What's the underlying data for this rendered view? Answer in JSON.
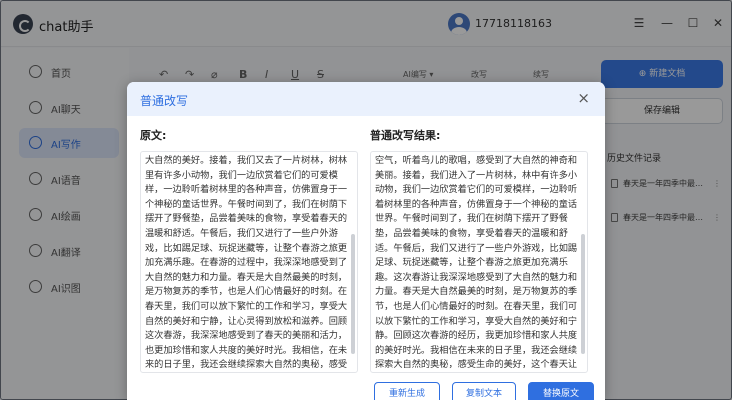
{
  "app": {
    "title": "chat助手",
    "phone": "17718118163",
    "window_controls": [
      "☰",
      "—",
      "☐",
      "✕"
    ]
  },
  "sidebar": {
    "items": [
      {
        "label": "首页",
        "icon": "home-icon",
        "active": false
      },
      {
        "label": "AI聊天",
        "icon": "chat-icon",
        "active": false
      },
      {
        "label": "AI写作",
        "icon": "write-icon",
        "active": true
      },
      {
        "label": "AI语音",
        "icon": "voice-icon",
        "active": false
      },
      {
        "label": "AI绘画",
        "icon": "palette-icon",
        "active": false
      },
      {
        "label": "AI翻译",
        "icon": "translate-icon",
        "active": false
      },
      {
        "label": "AI识图",
        "icon": "scan-icon",
        "active": false
      }
    ]
  },
  "toolbar": {
    "icons": [
      "↶",
      "↷",
      "⌀",
      "B",
      "I",
      "U",
      "S"
    ],
    "labels": [
      "AI编写 ▾",
      "改写",
      "续写"
    ]
  },
  "right_panel": {
    "new_button": "⊕ 新建文档",
    "secondary_button": "保存编辑",
    "history_heading": "历史文件记录",
    "history_items": [
      "春天是一年四季中最…",
      "春天是一年四季中最…"
    ]
  },
  "modal": {
    "title": "普通改写",
    "close_icon": "×",
    "original_label": "原文:",
    "result_label": "普通改写结果:",
    "original_text": "大自然的美好。接着，我们又去了一片树林，树林里有许多小动物，我们一边欣赏着它们的可爱模样，一边聆听着树林里的各种声音，仿佛置身于一个神秘的童话世界。午餐时间到了，我们在树荫下摆开了野餐垫，品尝着美味的食物，享受着春天的温暖和舒适。午餐后，我们又进行了一些户外游戏，比如踢足球、玩捉迷藏等，让整个春游之旅更加充满乐趣。在春游的过程中，我深深地感受到了大自然的魅力和力量。春天是大自然最美的时刻，是万物复苏的季节，也是人们心情最好的时刻。在春天里，我们可以放下繁忙的工作和学习，享受大自然的美好和宁静，让心灵得到放松和滋养。回顾这次春游，我深深地感受到了春天的美丽和活力，也更加珍惜和家人共度的美好时光。我相信，在未来的日子里，我还会继续探索大自然的奥秘，感受生命的美好。",
    "result_text": "空气，听着鸟儿的歌唱，感受到了大自然的神奇和美丽。接着，我们进入了一片树林，林中有许多小动物，我们一边欣赏着它们的可爱模样，一边聆听着树林里的各种声音，仿佛置身于一个神秘的童话世界。午餐时间到了，我们在树荫下摆开了野餐垫，品尝着美味的食物，享受着春天的温暖和舒适。午餐后，我们又进行了一些户外游戏，比如踢足球、玩捉迷藏等，让整个春游之旅更加充满乐趣。这次春游让我深深地感受到了大自然的魅力和力量。春天是大自然最美的时刻，是万物复苏的季节，也是人们心情最好的时刻。在春天里，我们可以放下繁忙的工作和学习，享受大自然的美好和宁静。回顾这次春游的经历，我更加珍惜和家人共度的美好时光。我相信在未来的日子里，我还会继续探索大自然的奥秘，感受生命的美好，这个春天让我更加热爱生活，热爱大自然。",
    "buttons": {
      "regenerate": "重新生成",
      "copy": "复制文本",
      "replace": "替换原文"
    }
  },
  "colors": {
    "accent": "#2f6fe0",
    "modal_header": "#eaf1fd",
    "overlay": "rgba(0,0,0,0.40)"
  }
}
